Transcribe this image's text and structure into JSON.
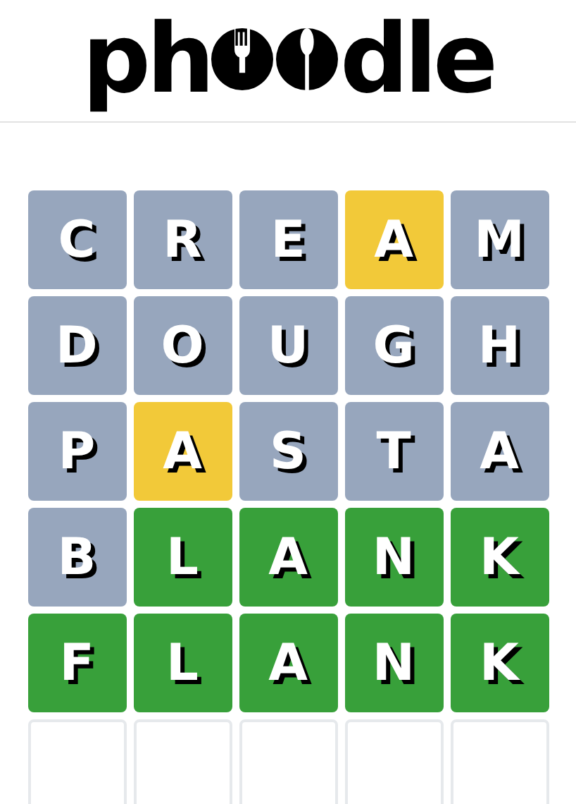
{
  "logo": {
    "before": "ph",
    "after": "dle"
  },
  "board": [
    {
      "tiles": [
        {
          "letter": "C",
          "kind": "absent"
        },
        {
          "letter": "R",
          "kind": "absent"
        },
        {
          "letter": "E",
          "kind": "absent"
        },
        {
          "letter": "A",
          "kind": "present"
        },
        {
          "letter": "M",
          "kind": "absent"
        }
      ]
    },
    {
      "tiles": [
        {
          "letter": "D",
          "kind": "absent"
        },
        {
          "letter": "O",
          "kind": "absent"
        },
        {
          "letter": "U",
          "kind": "absent"
        },
        {
          "letter": "G",
          "kind": "absent"
        },
        {
          "letter": "H",
          "kind": "absent"
        }
      ]
    },
    {
      "tiles": [
        {
          "letter": "P",
          "kind": "absent"
        },
        {
          "letter": "A",
          "kind": "present"
        },
        {
          "letter": "S",
          "kind": "absent"
        },
        {
          "letter": "T",
          "kind": "absent"
        },
        {
          "letter": "A",
          "kind": "absent"
        }
      ]
    },
    {
      "tiles": [
        {
          "letter": "B",
          "kind": "absent"
        },
        {
          "letter": "L",
          "kind": "correct"
        },
        {
          "letter": "A",
          "kind": "correct"
        },
        {
          "letter": "N",
          "kind": "correct"
        },
        {
          "letter": "K",
          "kind": "correct"
        }
      ]
    },
    {
      "tiles": [
        {
          "letter": "F",
          "kind": "correct"
        },
        {
          "letter": "L",
          "kind": "correct"
        },
        {
          "letter": "A",
          "kind": "correct"
        },
        {
          "letter": "N",
          "kind": "correct"
        },
        {
          "letter": "K",
          "kind": "correct"
        }
      ]
    },
    {
      "tiles": [
        {
          "kind": "empty"
        },
        {
          "kind": "empty"
        },
        {
          "kind": "empty"
        },
        {
          "kind": "empty"
        },
        {
          "kind": "empty"
        }
      ]
    }
  ]
}
